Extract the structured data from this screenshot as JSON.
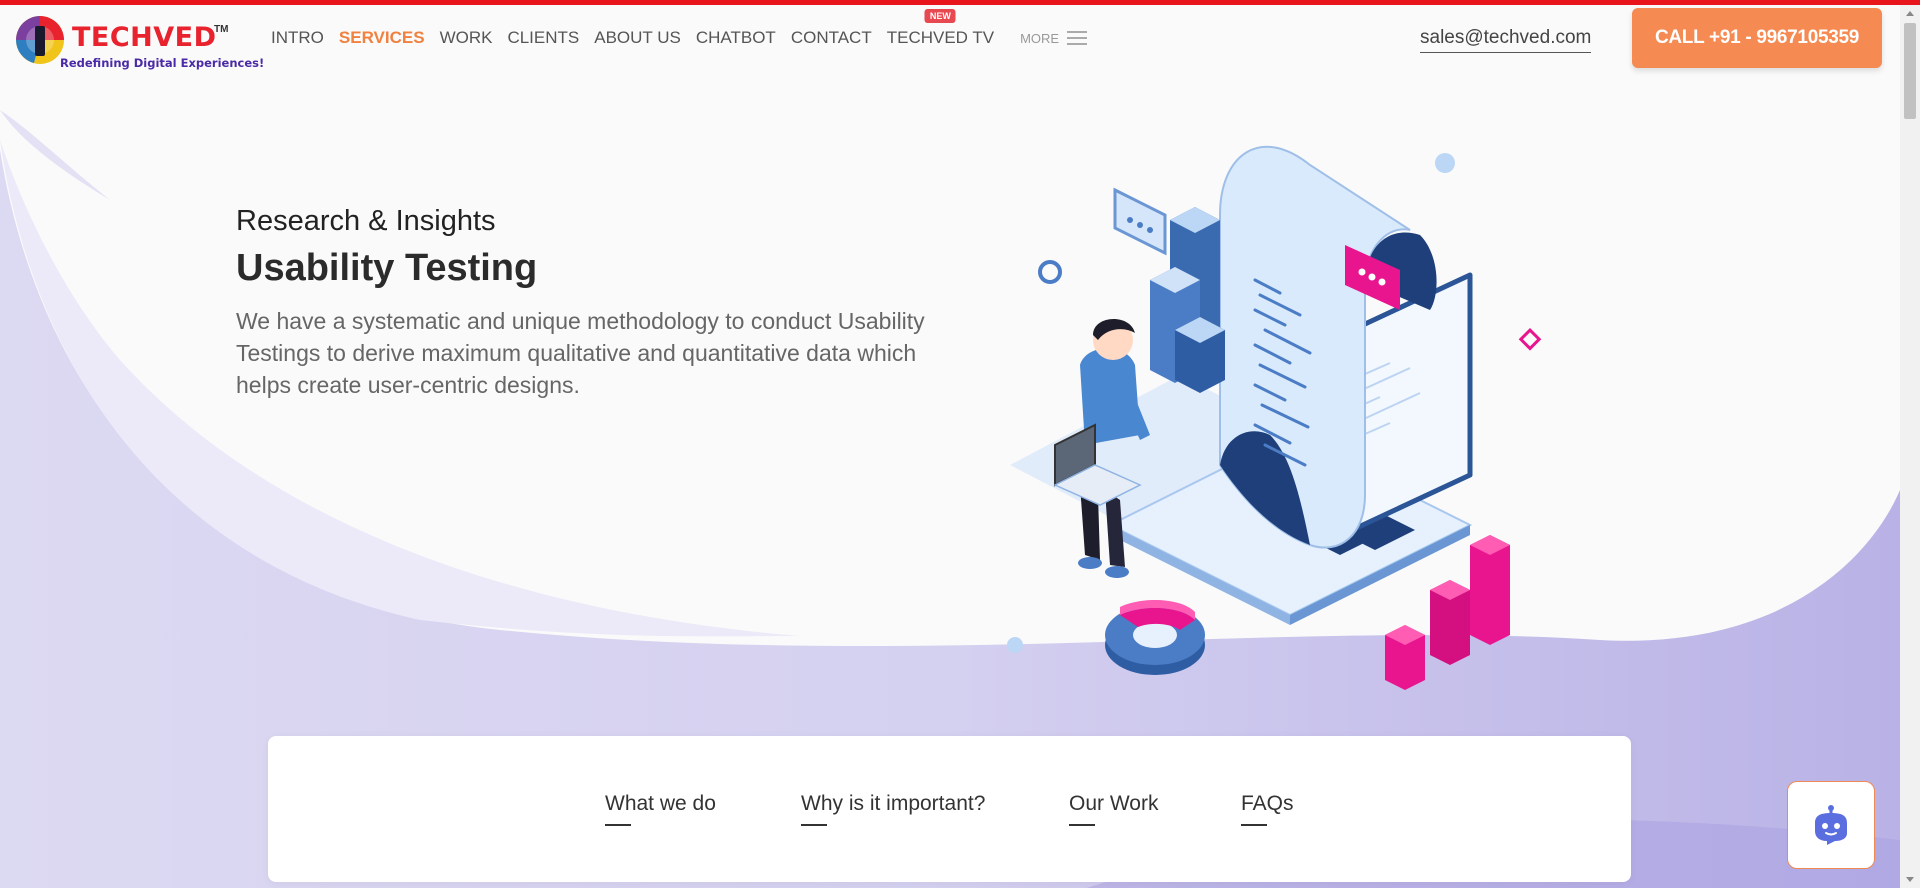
{
  "header": {
    "logo": {
      "name": "TECHVED",
      "trademark": "TM",
      "tagline": "Redefining Digital Experiences!"
    },
    "nav": [
      {
        "label": "INTRO",
        "active": false
      },
      {
        "label": "SERVICES",
        "active": true
      },
      {
        "label": "WORK",
        "active": false
      },
      {
        "label": "CLIENTS",
        "active": false
      },
      {
        "label": "ABOUT US",
        "active": false
      },
      {
        "label": "CHATBOT",
        "active": false
      },
      {
        "label": "CONTACT",
        "active": false
      },
      {
        "label": "TECHVED TV",
        "active": false,
        "badge": "NEW"
      }
    ],
    "more_label": "MORE",
    "email": "sales@techved.com",
    "call_label": "CALL +91 - 9967105359"
  },
  "hero": {
    "subtitle": "Research & Insights",
    "title": "Usability Testing",
    "description": "We have a systematic and unique methodology to conduct Usability Testings to derive maximum qualitative and quantitative data which helps create user-centric designs."
  },
  "tabs": [
    {
      "label": "What we do"
    },
    {
      "label": "Why is it important?"
    },
    {
      "label": "Our Work"
    },
    {
      "label": "FAQs"
    }
  ],
  "colors": {
    "accent": "#f58a52",
    "brand_red": "#e8232e",
    "top_bar": "#e8161c",
    "wave": "#cbc6ec",
    "pink": "#e8158f",
    "blue": "#3a6bb0"
  },
  "icons": {
    "chatbot": "robot-face-icon",
    "more": "hamburger-menu-icon"
  }
}
